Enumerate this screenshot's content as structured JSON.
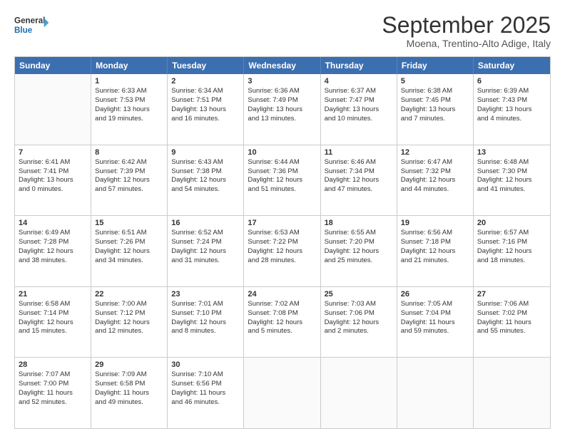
{
  "header": {
    "logo_line1": "General",
    "logo_line2": "Blue",
    "title": "September 2025",
    "subtitle": "Moena, Trentino-Alto Adige, Italy"
  },
  "calendar": {
    "days": [
      "Sunday",
      "Monday",
      "Tuesday",
      "Wednesday",
      "Thursday",
      "Friday",
      "Saturday"
    ],
    "rows": [
      [
        {
          "day": "",
          "empty": true
        },
        {
          "day": "1",
          "line1": "Sunrise: 6:33 AM",
          "line2": "Sunset: 7:53 PM",
          "line3": "Daylight: 13 hours",
          "line4": "and 19 minutes."
        },
        {
          "day": "2",
          "line1": "Sunrise: 6:34 AM",
          "line2": "Sunset: 7:51 PM",
          "line3": "Daylight: 13 hours",
          "line4": "and 16 minutes."
        },
        {
          "day": "3",
          "line1": "Sunrise: 6:36 AM",
          "line2": "Sunset: 7:49 PM",
          "line3": "Daylight: 13 hours",
          "line4": "and 13 minutes."
        },
        {
          "day": "4",
          "line1": "Sunrise: 6:37 AM",
          "line2": "Sunset: 7:47 PM",
          "line3": "Daylight: 13 hours",
          "line4": "and 10 minutes."
        },
        {
          "day": "5",
          "line1": "Sunrise: 6:38 AM",
          "line2": "Sunset: 7:45 PM",
          "line3": "Daylight: 13 hours",
          "line4": "and 7 minutes."
        },
        {
          "day": "6",
          "line1": "Sunrise: 6:39 AM",
          "line2": "Sunset: 7:43 PM",
          "line3": "Daylight: 13 hours",
          "line4": "and 4 minutes."
        }
      ],
      [
        {
          "day": "7",
          "line1": "Sunrise: 6:41 AM",
          "line2": "Sunset: 7:41 PM",
          "line3": "Daylight: 13 hours",
          "line4": "and 0 minutes."
        },
        {
          "day": "8",
          "line1": "Sunrise: 6:42 AM",
          "line2": "Sunset: 7:39 PM",
          "line3": "Daylight: 12 hours",
          "line4": "and 57 minutes."
        },
        {
          "day": "9",
          "line1": "Sunrise: 6:43 AM",
          "line2": "Sunset: 7:38 PM",
          "line3": "Daylight: 12 hours",
          "line4": "and 54 minutes."
        },
        {
          "day": "10",
          "line1": "Sunrise: 6:44 AM",
          "line2": "Sunset: 7:36 PM",
          "line3": "Daylight: 12 hours",
          "line4": "and 51 minutes."
        },
        {
          "day": "11",
          "line1": "Sunrise: 6:46 AM",
          "line2": "Sunset: 7:34 PM",
          "line3": "Daylight: 12 hours",
          "line4": "and 47 minutes."
        },
        {
          "day": "12",
          "line1": "Sunrise: 6:47 AM",
          "line2": "Sunset: 7:32 PM",
          "line3": "Daylight: 12 hours",
          "line4": "and 44 minutes."
        },
        {
          "day": "13",
          "line1": "Sunrise: 6:48 AM",
          "line2": "Sunset: 7:30 PM",
          "line3": "Daylight: 12 hours",
          "line4": "and 41 minutes."
        }
      ],
      [
        {
          "day": "14",
          "line1": "Sunrise: 6:49 AM",
          "line2": "Sunset: 7:28 PM",
          "line3": "Daylight: 12 hours",
          "line4": "and 38 minutes."
        },
        {
          "day": "15",
          "line1": "Sunrise: 6:51 AM",
          "line2": "Sunset: 7:26 PM",
          "line3": "Daylight: 12 hours",
          "line4": "and 34 minutes."
        },
        {
          "day": "16",
          "line1": "Sunrise: 6:52 AM",
          "line2": "Sunset: 7:24 PM",
          "line3": "Daylight: 12 hours",
          "line4": "and 31 minutes."
        },
        {
          "day": "17",
          "line1": "Sunrise: 6:53 AM",
          "line2": "Sunset: 7:22 PM",
          "line3": "Daylight: 12 hours",
          "line4": "and 28 minutes."
        },
        {
          "day": "18",
          "line1": "Sunrise: 6:55 AM",
          "line2": "Sunset: 7:20 PM",
          "line3": "Daylight: 12 hours",
          "line4": "and 25 minutes."
        },
        {
          "day": "19",
          "line1": "Sunrise: 6:56 AM",
          "line2": "Sunset: 7:18 PM",
          "line3": "Daylight: 12 hours",
          "line4": "and 21 minutes."
        },
        {
          "day": "20",
          "line1": "Sunrise: 6:57 AM",
          "line2": "Sunset: 7:16 PM",
          "line3": "Daylight: 12 hours",
          "line4": "and 18 minutes."
        }
      ],
      [
        {
          "day": "21",
          "line1": "Sunrise: 6:58 AM",
          "line2": "Sunset: 7:14 PM",
          "line3": "Daylight: 12 hours",
          "line4": "and 15 minutes."
        },
        {
          "day": "22",
          "line1": "Sunrise: 7:00 AM",
          "line2": "Sunset: 7:12 PM",
          "line3": "Daylight: 12 hours",
          "line4": "and 12 minutes."
        },
        {
          "day": "23",
          "line1": "Sunrise: 7:01 AM",
          "line2": "Sunset: 7:10 PM",
          "line3": "Daylight: 12 hours",
          "line4": "and 8 minutes."
        },
        {
          "day": "24",
          "line1": "Sunrise: 7:02 AM",
          "line2": "Sunset: 7:08 PM",
          "line3": "Daylight: 12 hours",
          "line4": "and 5 minutes."
        },
        {
          "day": "25",
          "line1": "Sunrise: 7:03 AM",
          "line2": "Sunset: 7:06 PM",
          "line3": "Daylight: 12 hours",
          "line4": "and 2 minutes."
        },
        {
          "day": "26",
          "line1": "Sunrise: 7:05 AM",
          "line2": "Sunset: 7:04 PM",
          "line3": "Daylight: 11 hours",
          "line4": "and 59 minutes."
        },
        {
          "day": "27",
          "line1": "Sunrise: 7:06 AM",
          "line2": "Sunset: 7:02 PM",
          "line3": "Daylight: 11 hours",
          "line4": "and 55 minutes."
        }
      ],
      [
        {
          "day": "28",
          "line1": "Sunrise: 7:07 AM",
          "line2": "Sunset: 7:00 PM",
          "line3": "Daylight: 11 hours",
          "line4": "and 52 minutes."
        },
        {
          "day": "29",
          "line1": "Sunrise: 7:09 AM",
          "line2": "Sunset: 6:58 PM",
          "line3": "Daylight: 11 hours",
          "line4": "and 49 minutes."
        },
        {
          "day": "30",
          "line1": "Sunrise: 7:10 AM",
          "line2": "Sunset: 6:56 PM",
          "line3": "Daylight: 11 hours",
          "line4": "and 46 minutes."
        },
        {
          "day": "",
          "empty": true
        },
        {
          "day": "",
          "empty": true
        },
        {
          "day": "",
          "empty": true
        },
        {
          "day": "",
          "empty": true
        }
      ]
    ]
  }
}
